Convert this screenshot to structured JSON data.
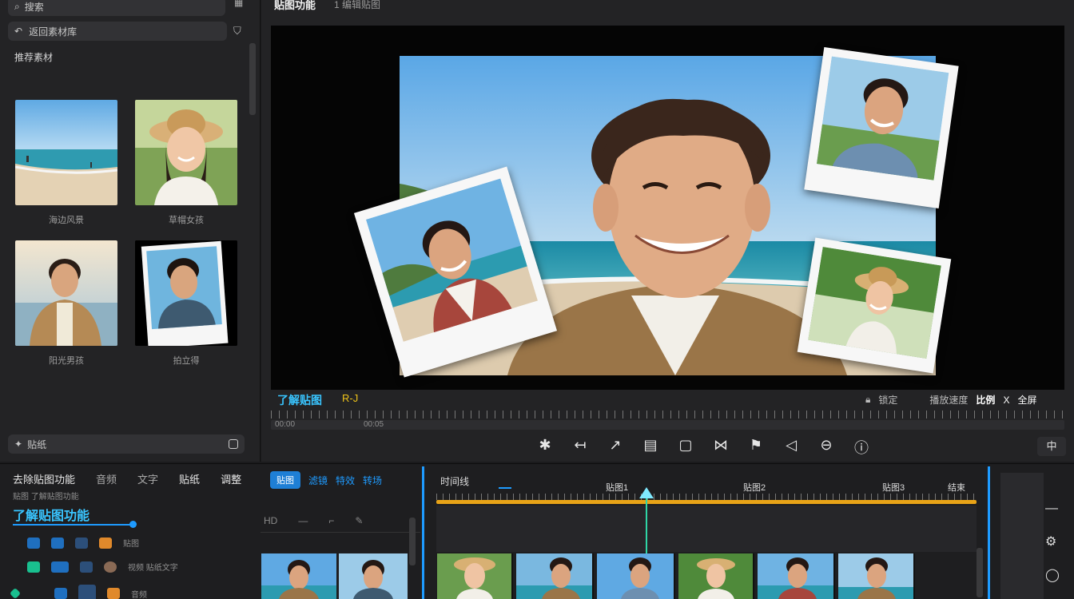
{
  "left_panel": {
    "top_pill": "搜索",
    "back_pill": "返回素材库",
    "section_title": "推荐素材",
    "thumbs": [
      {
        "caption": "海边风景"
      },
      {
        "caption": "草帽女孩"
      },
      {
        "caption": "阳光男孩"
      },
      {
        "caption": "拍立得"
      }
    ],
    "bottom_pill": "贴纸"
  },
  "preview": {
    "title": "贴图功能",
    "subtitle": "1 编辑贴图",
    "caption_left": "了解贴图",
    "caption_tag": "R-J",
    "right_labels": [
      "锁定",
      "播放速度",
      "比例",
      "X",
      "全屏"
    ],
    "time_left": "00:00",
    "time_mid": "00:05"
  },
  "toolbar": {
    "icons": [
      "cut-icon",
      "undo-icon",
      "redo-icon",
      "copy-icon",
      "crop-icon",
      "mirror-icon",
      "flag-icon",
      "audio-icon",
      "box-icon",
      "info-icon"
    ],
    "right_btn": "中"
  },
  "bottom": {
    "tabs": [
      "去除贴图功能",
      "音频",
      "文字",
      "贴纸",
      "调整"
    ],
    "sub_caption": "贴图 了解贴图功能",
    "main_heading": "了解贴图功能",
    "chips": [
      "贴图",
      "滤镜",
      "特效",
      "转场"
    ],
    "track_labels": [
      "贴图",
      "视频 贴纸文字",
      "音频"
    ],
    "timeline_heading": "时间线",
    "markers": [
      "贴图1",
      "贴图2",
      "贴图3",
      "结束"
    ]
  },
  "colors": {
    "accent": "#1e9bff",
    "timeline_bar": "#e8a317",
    "playhead": "#2fd6a6",
    "caption_cyan": "#39c5ff",
    "caption_yellow": "#f0c419"
  }
}
